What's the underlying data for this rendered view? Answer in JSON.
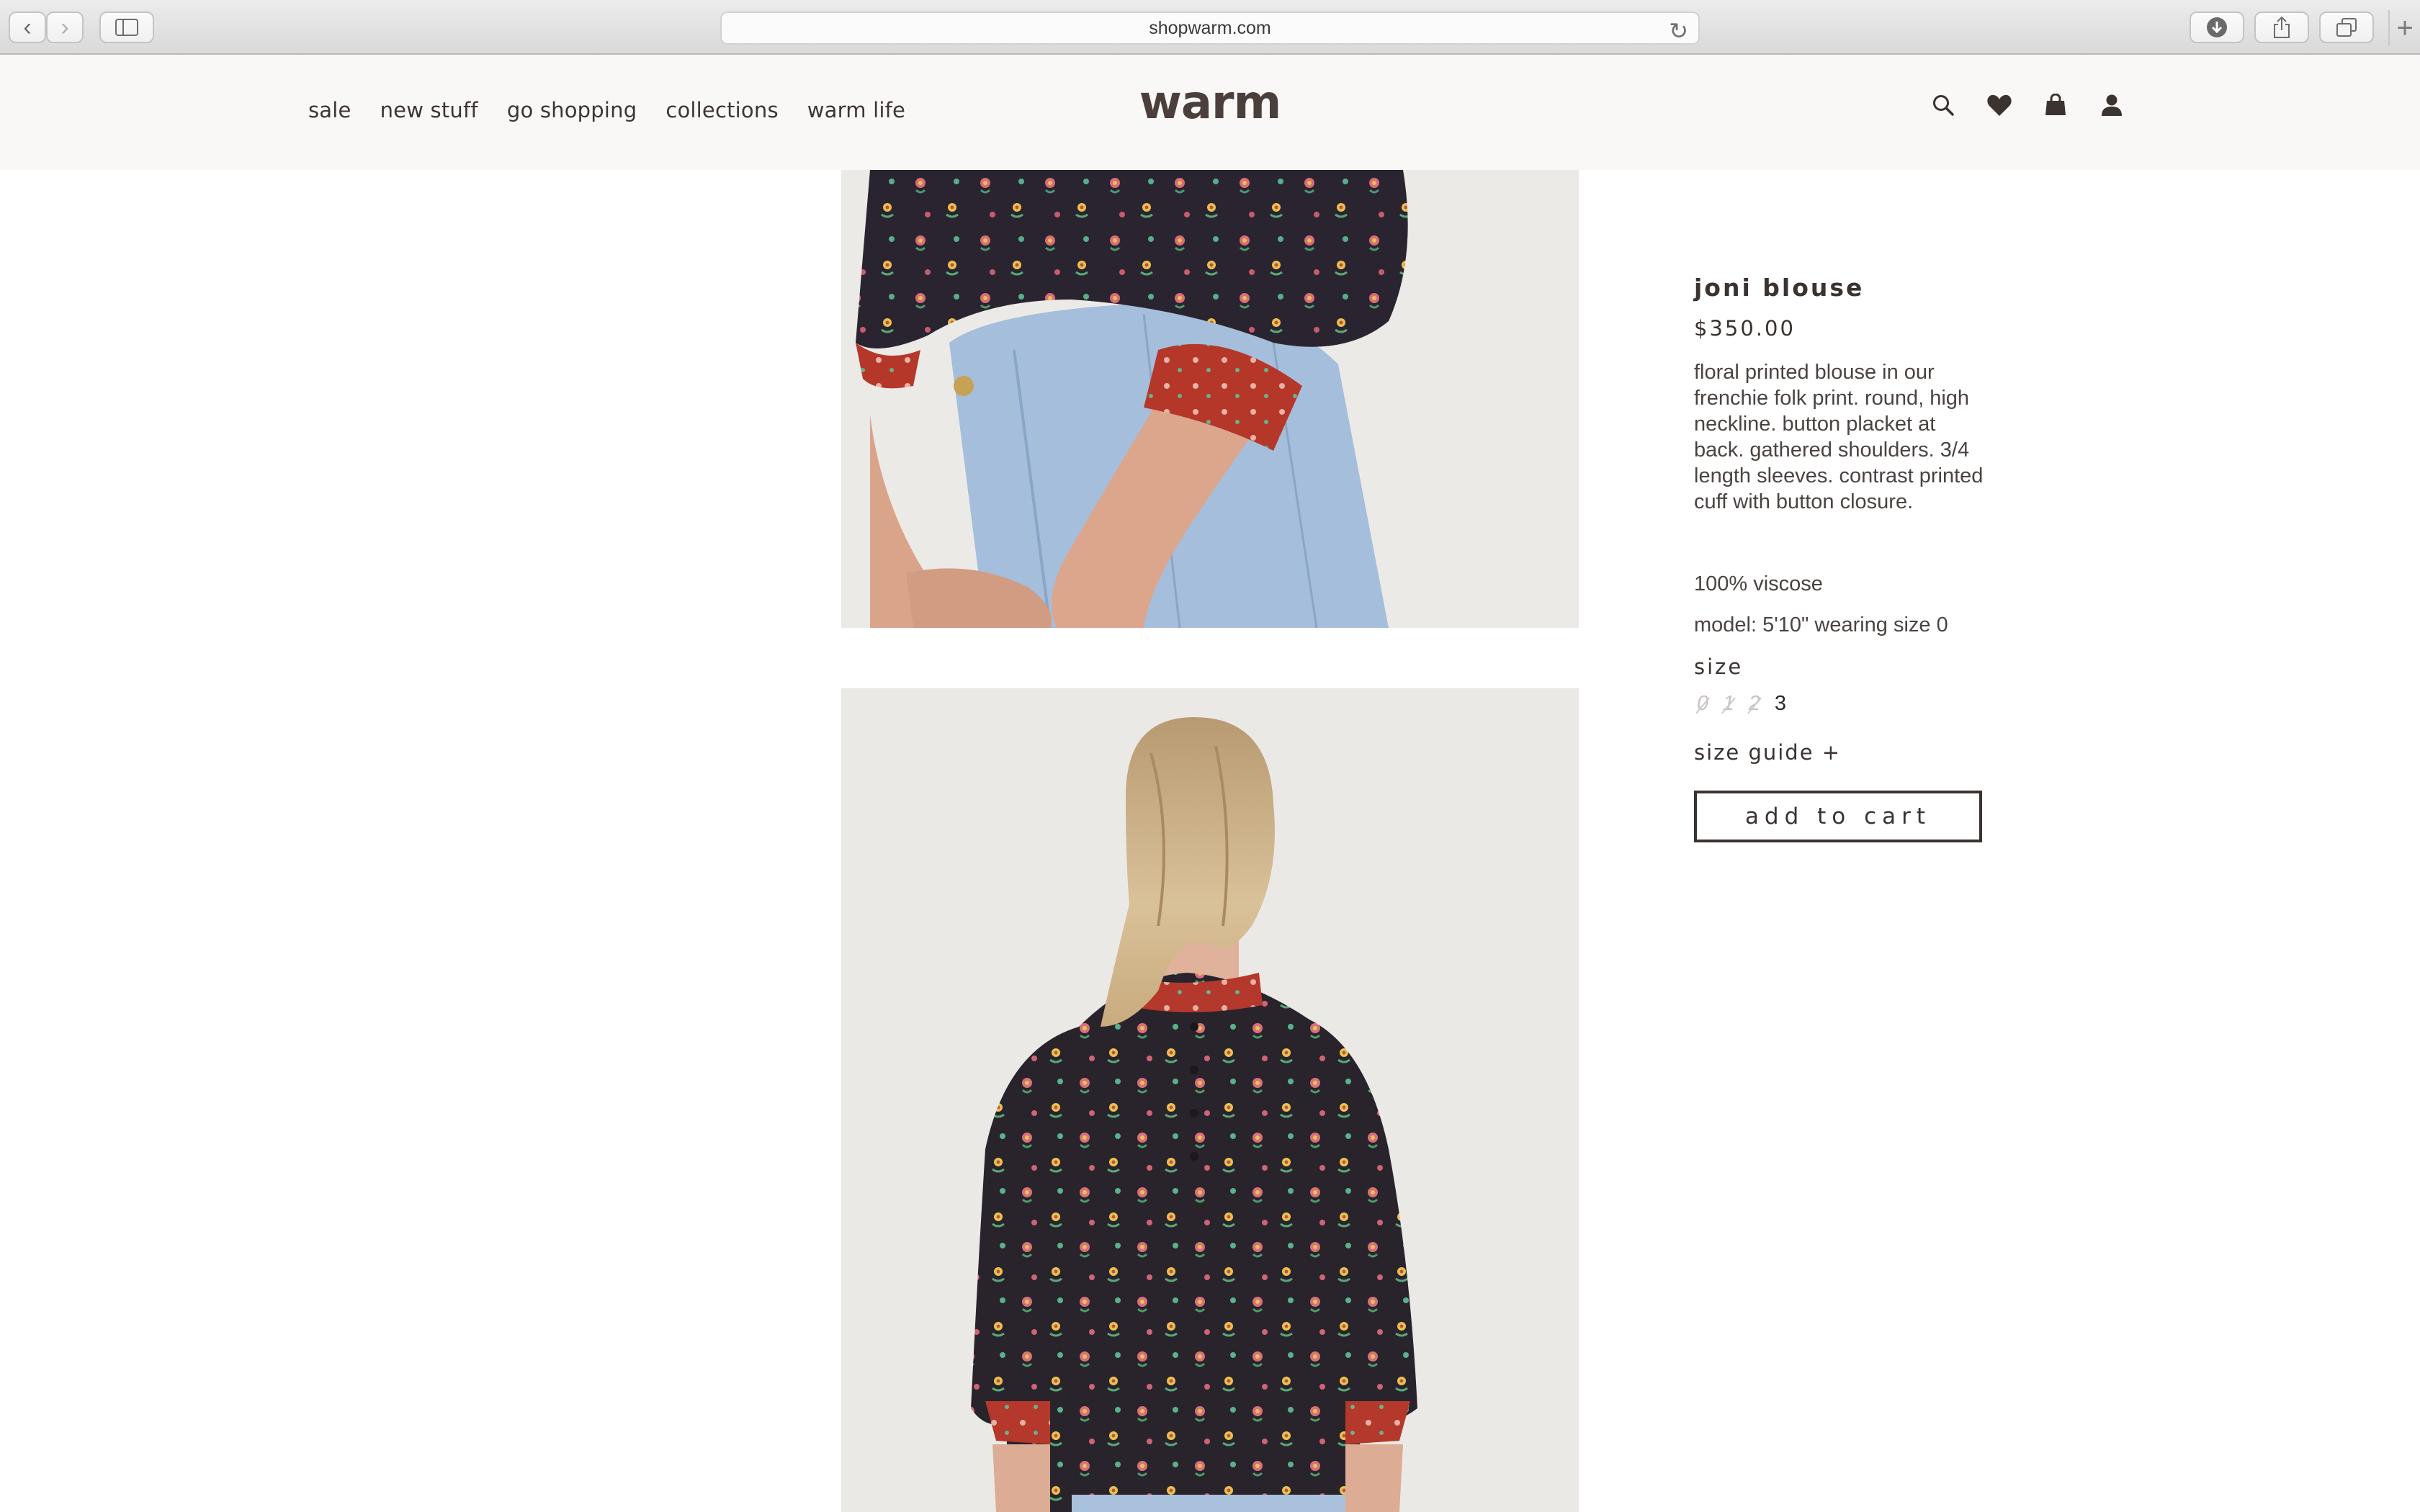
{
  "browser": {
    "url": "shopwarm.com",
    "icons": [
      "chevron-left-icon",
      "chevron-right-icon",
      "sidebar-icon",
      "reload-icon",
      "download-icon",
      "share-icon",
      "tabs-icon",
      "plus-icon"
    ]
  },
  "header": {
    "nav": [
      "sale",
      "new stuff",
      "go shopping",
      "collections",
      "warm life"
    ],
    "logo": "warm",
    "icons": [
      "search-icon",
      "heart-icon",
      "shopping-bag-icon",
      "user-icon"
    ]
  },
  "product": {
    "title": "joni blouse",
    "price": "$350.00",
    "description": "floral printed blouse in our frenchie folk print. round, high neckline. button placket at back. gathered shoulders. 3/4 length sleeves. contrast printed cuff with button closure.",
    "material": "100% viscose",
    "model": "model: 5'10\" wearing size 0",
    "size_label": "size",
    "sizes": [
      {
        "label": "0",
        "available": false
      },
      {
        "label": "1",
        "available": false
      },
      {
        "label": "2",
        "available": false
      },
      {
        "label": "3",
        "available": true
      }
    ],
    "size_guide": "size guide +",
    "add_to_cart": "add to cart"
  },
  "colors": {
    "header_bg": "#faf8f6",
    "text": "#3a3330",
    "print_dark": "#2a2430",
    "cuff_red": "#b5372a",
    "denim": "#9fb8d6"
  }
}
